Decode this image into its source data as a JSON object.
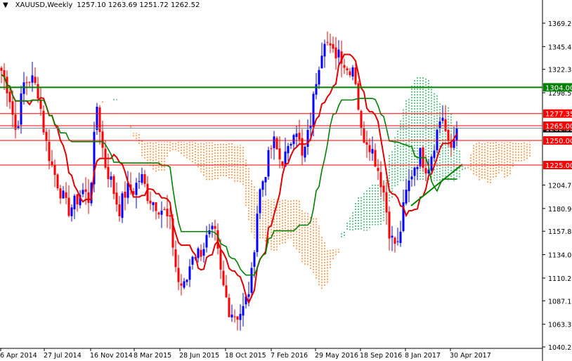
{
  "header": {
    "symbol": "XAUUSD,Weekly",
    "ohlc": "1257.10 1263.69 1251.72 1262.52",
    "menu_icon": "triangle-down-icon"
  },
  "chart_data": {
    "type": "candlestick",
    "title": "XAUUSD,Weekly",
    "ylim": [
      1040.2,
      1369.2
    ],
    "y_ticks": [
      "1369.20",
      "1345.40",
      "1322.30",
      "1298.50",
      "1204.70",
      "1180.90",
      "1157.80",
      "1134.00",
      "1110.20",
      "1087.10",
      "1063.30",
      "1040.20"
    ],
    "x_ticks": [
      "6 Apr 2014",
      "27 Jul 2014",
      "16 Nov 2014",
      "8 Mar 2015",
      "28 Jun 2015",
      "18 Oct 2015",
      "7 Feb 2016",
      "29 May 2016",
      "18 Sep 2016",
      "8 Jan 2017",
      "30 Apr 2017"
    ],
    "approx_close_path": [
      1321,
      1300,
      1257,
      1307,
      1314,
      1300,
      1250,
      1221,
      1200,
      1179,
      1186,
      1200,
      1189,
      1286,
      1229,
      1207,
      1179,
      1200,
      1200,
      1214,
      1193,
      1186,
      1179,
      1164,
      1107,
      1100,
      1136,
      1136,
      1150,
      1157,
      1107,
      1079,
      1072,
      1079,
      1107,
      1193,
      1221,
      1250,
      1229,
      1236,
      1271,
      1229,
      1264,
      1321,
      1357,
      1336,
      1343,
      1321,
      1328,
      1257,
      1250,
      1229,
      1200,
      1150,
      1143,
      1193,
      1221,
      1236,
      1221,
      1250,
      1279,
      1236,
      1262.52
    ],
    "horizontal_levels": [
      {
        "value": 1304.0,
        "label": "1304.00",
        "color": "#008000"
      },
      {
        "value": 1277.35,
        "label": "1277.35",
        "color": "#ff0000"
      },
      {
        "value": 1265.0,
        "label": "1265.00",
        "color": "#ff0000"
      },
      {
        "value": 1250.0,
        "label": "1250.00",
        "color": "#ff0000"
      },
      {
        "value": 1225.0,
        "label": "1225.00",
        "color": "#ff0000"
      }
    ],
    "current_price": {
      "value": 1262.52,
      "label": "1262.52"
    },
    "colors": {
      "bull": "#0000ff",
      "bear": "#ff0000",
      "tenkan": "#e00000",
      "kijun": "#008000",
      "cloud_bear": "#ff6a00",
      "cloud_bull": "#00a040"
    },
    "indicator": "Ichimoku Kinko Hyo"
  }
}
